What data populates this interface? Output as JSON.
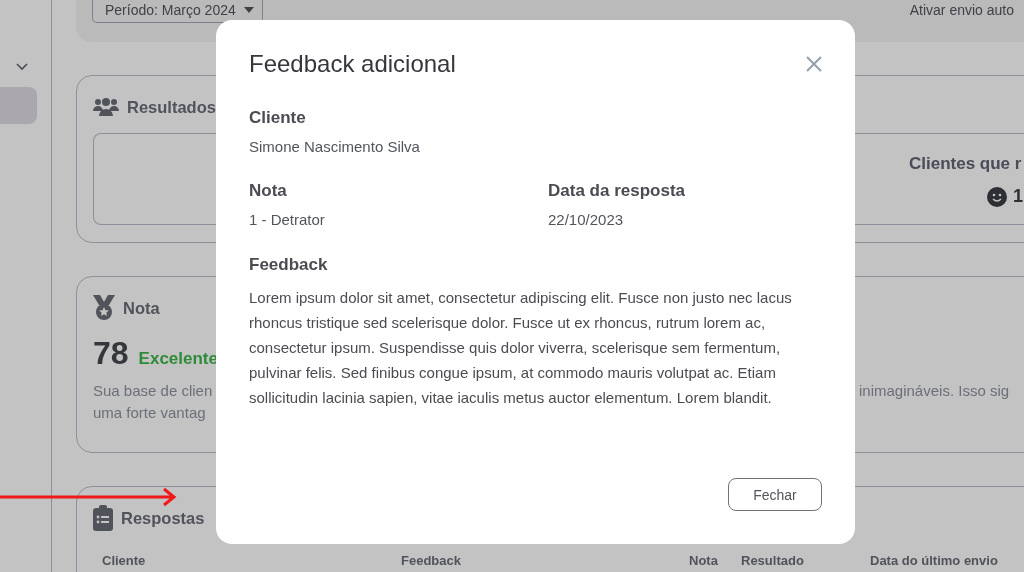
{
  "filters": {
    "period_dropdown": "Período: Março 2024",
    "auto_send_label": "Ativar envio auto"
  },
  "results_card": {
    "title": "Resultados",
    "metric_label": "Clientes que r",
    "metric_value": "1"
  },
  "score_card": {
    "title": "Nota",
    "score": "78",
    "rating": "Excelente",
    "description_left": [
      "Sua base de clien",
      "uma forte vantag"
    ],
    "description_right": "inimagináveis. Isso sig"
  },
  "responses_card": {
    "title": "Respostas",
    "columns": [
      "Cliente",
      "Feedback",
      "Nota",
      "Resultado",
      "Data do último envio"
    ]
  },
  "modal": {
    "title": "Feedback adicional",
    "fields": [
      {
        "label": "Cliente",
        "value": "Simone Nascimento Silva"
      },
      {
        "label": "Nota",
        "value": "1 - Detrator"
      },
      {
        "label": "Data da resposta",
        "value": "22/10/2023"
      }
    ],
    "feedback": {
      "label": "Feedback",
      "text": "Lorem ipsum dolor sit amet, consectetur adipiscing elit. Fusce non justo nec lacus rhoncus tristique sed scelerisque dolor. Fusce ut ex rhoncus, rutrum lorem ac, consectetur ipsum. Suspendisse quis dolor viverra, scelerisque sem fermentum, pulvinar felis. Sed finibus congue ipsum, at commodo mauris volutpat ac. Etiam sollicitudin lacinia sapien, vitae iaculis metus auctor elementum. Lorem blandit."
    },
    "close_button": "Fechar"
  }
}
